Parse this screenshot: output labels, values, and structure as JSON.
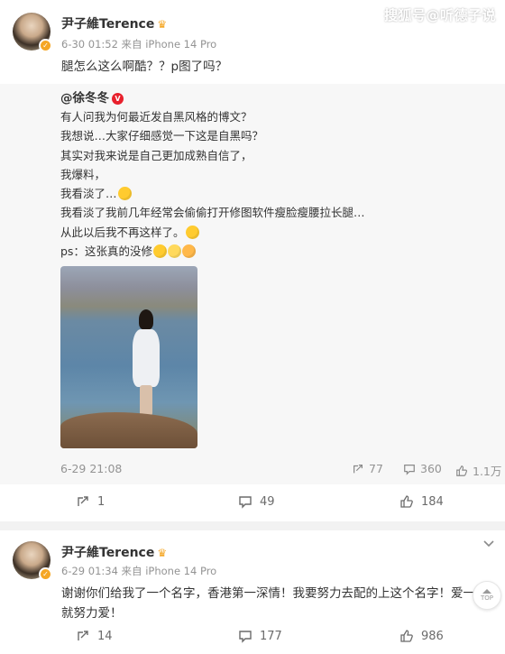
{
  "watermark": "搜狐号@听德子说",
  "post1": {
    "username": "尹子維Terence",
    "crown": "♛",
    "meta": "6-30 01:52 来自 iPhone 14 Pro",
    "text": "腿怎么这么啊酷？？p图了吗？",
    "repost": {
      "author": "@徐冬冬",
      "badge": "V",
      "lines": [
        "有人问我为何最近发自黑风格的博文？",
        "我想说…大家仔细感觉一下这是自黑吗？",
        "其实对我来说是自己更加成熟自信了，",
        "我爆料，",
        "我看淡了…",
        "我看淡了我前几年经常会偷偷打开修图软件瘦脸瘦腰拉长腿…",
        "从此以后我不再这样了。",
        "ps：这张真的没修"
      ],
      "footer": {
        "time": "6-29 21:08",
        "reposts": "77",
        "comments": "360",
        "likes": "1.1万"
      }
    },
    "actions": {
      "reposts": "1",
      "comments": "49",
      "likes": "184"
    }
  },
  "post2": {
    "username": "尹子維Terence",
    "crown": "♛",
    "meta": "6-29 01:34 来自 iPhone 14 Pro",
    "text_line1": "谢谢你们给我了一个名字，香港第一深情！我要努力去配的上这个名字！爱一",
    "text_line2": "就努力爱！",
    "actions": {
      "reposts": "14",
      "comments": "177",
      "likes": "986"
    }
  },
  "top_button": "TOP"
}
